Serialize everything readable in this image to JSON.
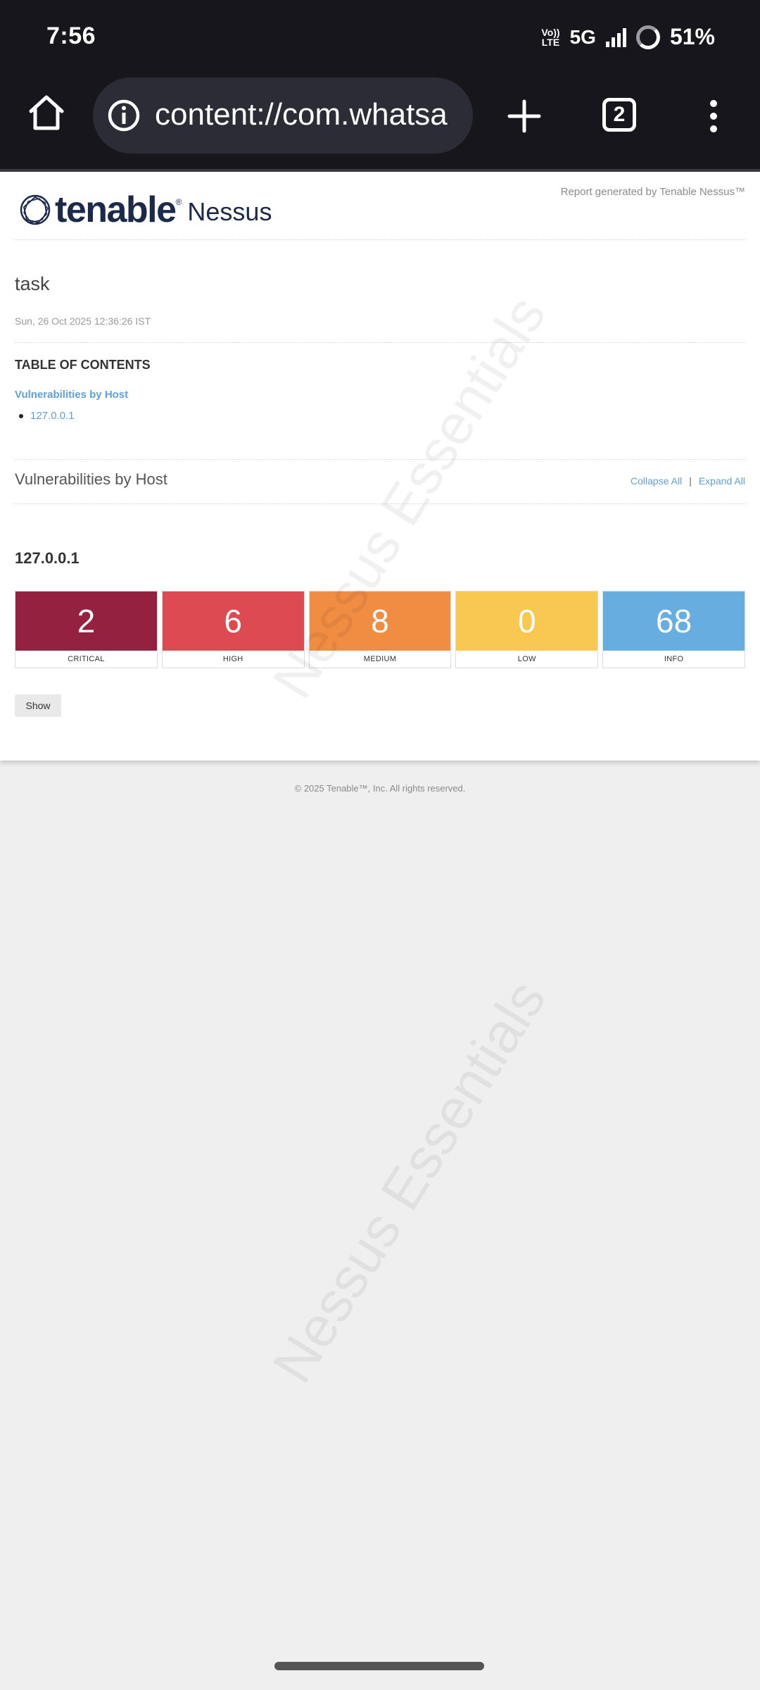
{
  "status_bar": {
    "time": "7:56",
    "volte_top": "Vo))",
    "volte_bottom": "LTE",
    "network": "5G",
    "battery": "51%"
  },
  "browser": {
    "url": "content://com.whatsa",
    "tab_count": "2"
  },
  "report": {
    "brand_name": "tenable",
    "brand_tm": "®",
    "product_name": "Nessus",
    "generated_by": "Report generated by Tenable Nessus™",
    "task_title": "task",
    "task_date": "Sun, 26 Oct 2025 12:36:26 IST",
    "toc": {
      "heading": "TABLE OF CONTENTS",
      "link": "Vulnerabilities by Host",
      "items": [
        "127.0.0.1"
      ]
    },
    "section": {
      "title": "Vulnerabilities by Host",
      "collapse_all": "Collapse All",
      "separator": "|",
      "expand_all": "Expand All"
    },
    "host": {
      "ip": "127.0.0.1",
      "severities": [
        {
          "count": "2",
          "label": "CRITICAL",
          "color": "#93213f"
        },
        {
          "count": "6",
          "label": "HIGH",
          "color": "#dd4a51"
        },
        {
          "count": "8",
          "label": "MEDIUM",
          "color": "#f18c43"
        },
        {
          "count": "0",
          "label": "LOW",
          "color": "#f8c851"
        },
        {
          "count": "68",
          "label": "INFO",
          "color": "#67ade0"
        }
      ],
      "show_button": "Show"
    },
    "watermark": "Nessus Essentials",
    "footer": "© 2025 Tenable™, Inc. All rights reserved."
  }
}
